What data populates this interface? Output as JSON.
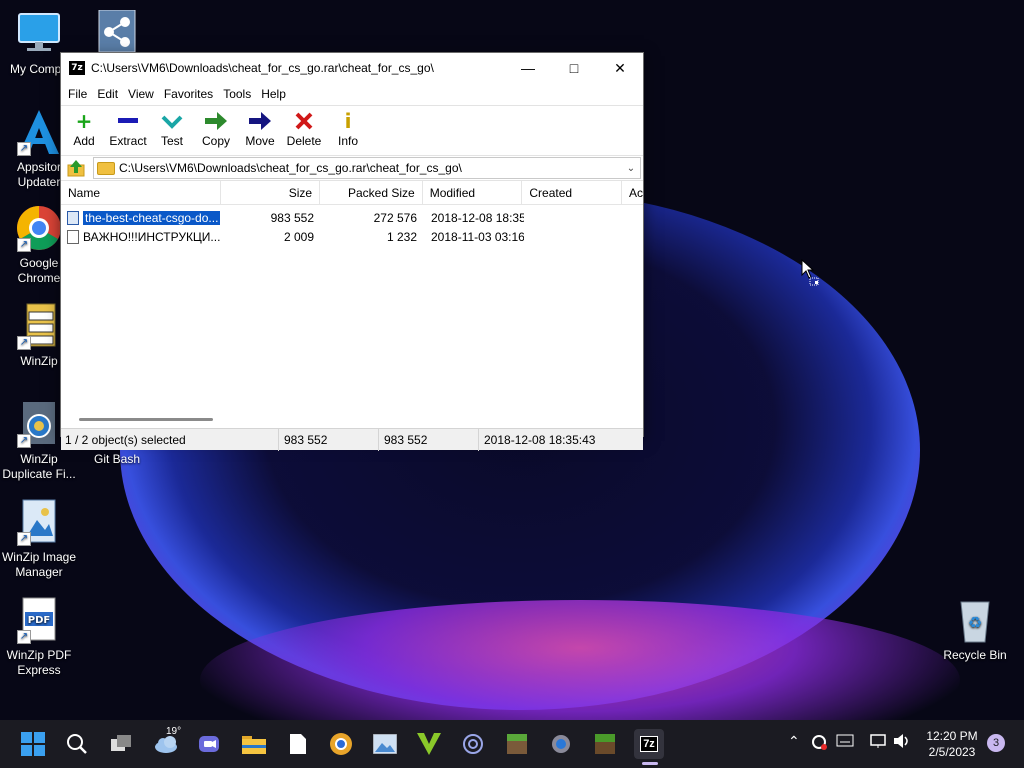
{
  "desktop": {
    "icons": [
      {
        "label": "My Compu"
      },
      {
        "label": "Appsitor Updater"
      },
      {
        "label": "Google Chrome"
      },
      {
        "label": "WinZip"
      },
      {
        "label": "WinZip Duplicate Fi..."
      },
      {
        "label": "Git Bash"
      },
      {
        "label": "WinZip Image Manager"
      },
      {
        "label": "WinZip PDF Express"
      },
      {
        "label": "Recycle Bin"
      }
    ]
  },
  "window": {
    "title": "C:\\Users\\VM6\\Downloads\\cheat_for_cs_go.rar\\cheat_for_cs_go\\",
    "app_icon": "7z",
    "menu": [
      "File",
      "Edit",
      "View",
      "Favorites",
      "Tools",
      "Help"
    ],
    "toolbar": [
      {
        "label": "Add",
        "icon": "plus-icon",
        "color": "#1aa51a"
      },
      {
        "label": "Extract",
        "icon": "minus-icon",
        "color": "#1b1bb5"
      },
      {
        "label": "Test",
        "icon": "check-icon",
        "color": "#1aa6a6"
      },
      {
        "label": "Copy",
        "icon": "arrow-right-icon",
        "color": "#2d8a2d"
      },
      {
        "label": "Move",
        "icon": "arrow-right-icon",
        "color": "#151580"
      },
      {
        "label": "Delete",
        "icon": "x-icon",
        "color": "#d01818"
      },
      {
        "label": "Info",
        "icon": "info-icon",
        "color": "#c8a000"
      }
    ],
    "address": "C:\\Users\\VM6\\Downloads\\cheat_for_cs_go.rar\\cheat_for_cs_go\\",
    "columns": {
      "name": "Name",
      "size": "Size",
      "packed": "Packed Size",
      "modified": "Modified",
      "created": "Created",
      "accessed": "Ac"
    },
    "files": [
      {
        "name": "the-best-cheat-csgo-do...",
        "size": "983 552",
        "packed": "272 576",
        "modified": "2018-12-08 18:35",
        "selected": true
      },
      {
        "name": "ВАЖНО!!!ИНСТРУКЦИ...",
        "size": "2 009",
        "packed": "1 232",
        "modified": "2018-11-03 03:16",
        "selected": false
      }
    ],
    "status": {
      "selection": "1 / 2 object(s) selected",
      "size": "983 552",
      "packed": "983 552",
      "modified": "2018-12-08 18:35:43"
    }
  },
  "taskbar": {
    "weather_temp": "19°",
    "time": "12:20 PM",
    "date": "2/5/2023",
    "notifications": "3"
  }
}
